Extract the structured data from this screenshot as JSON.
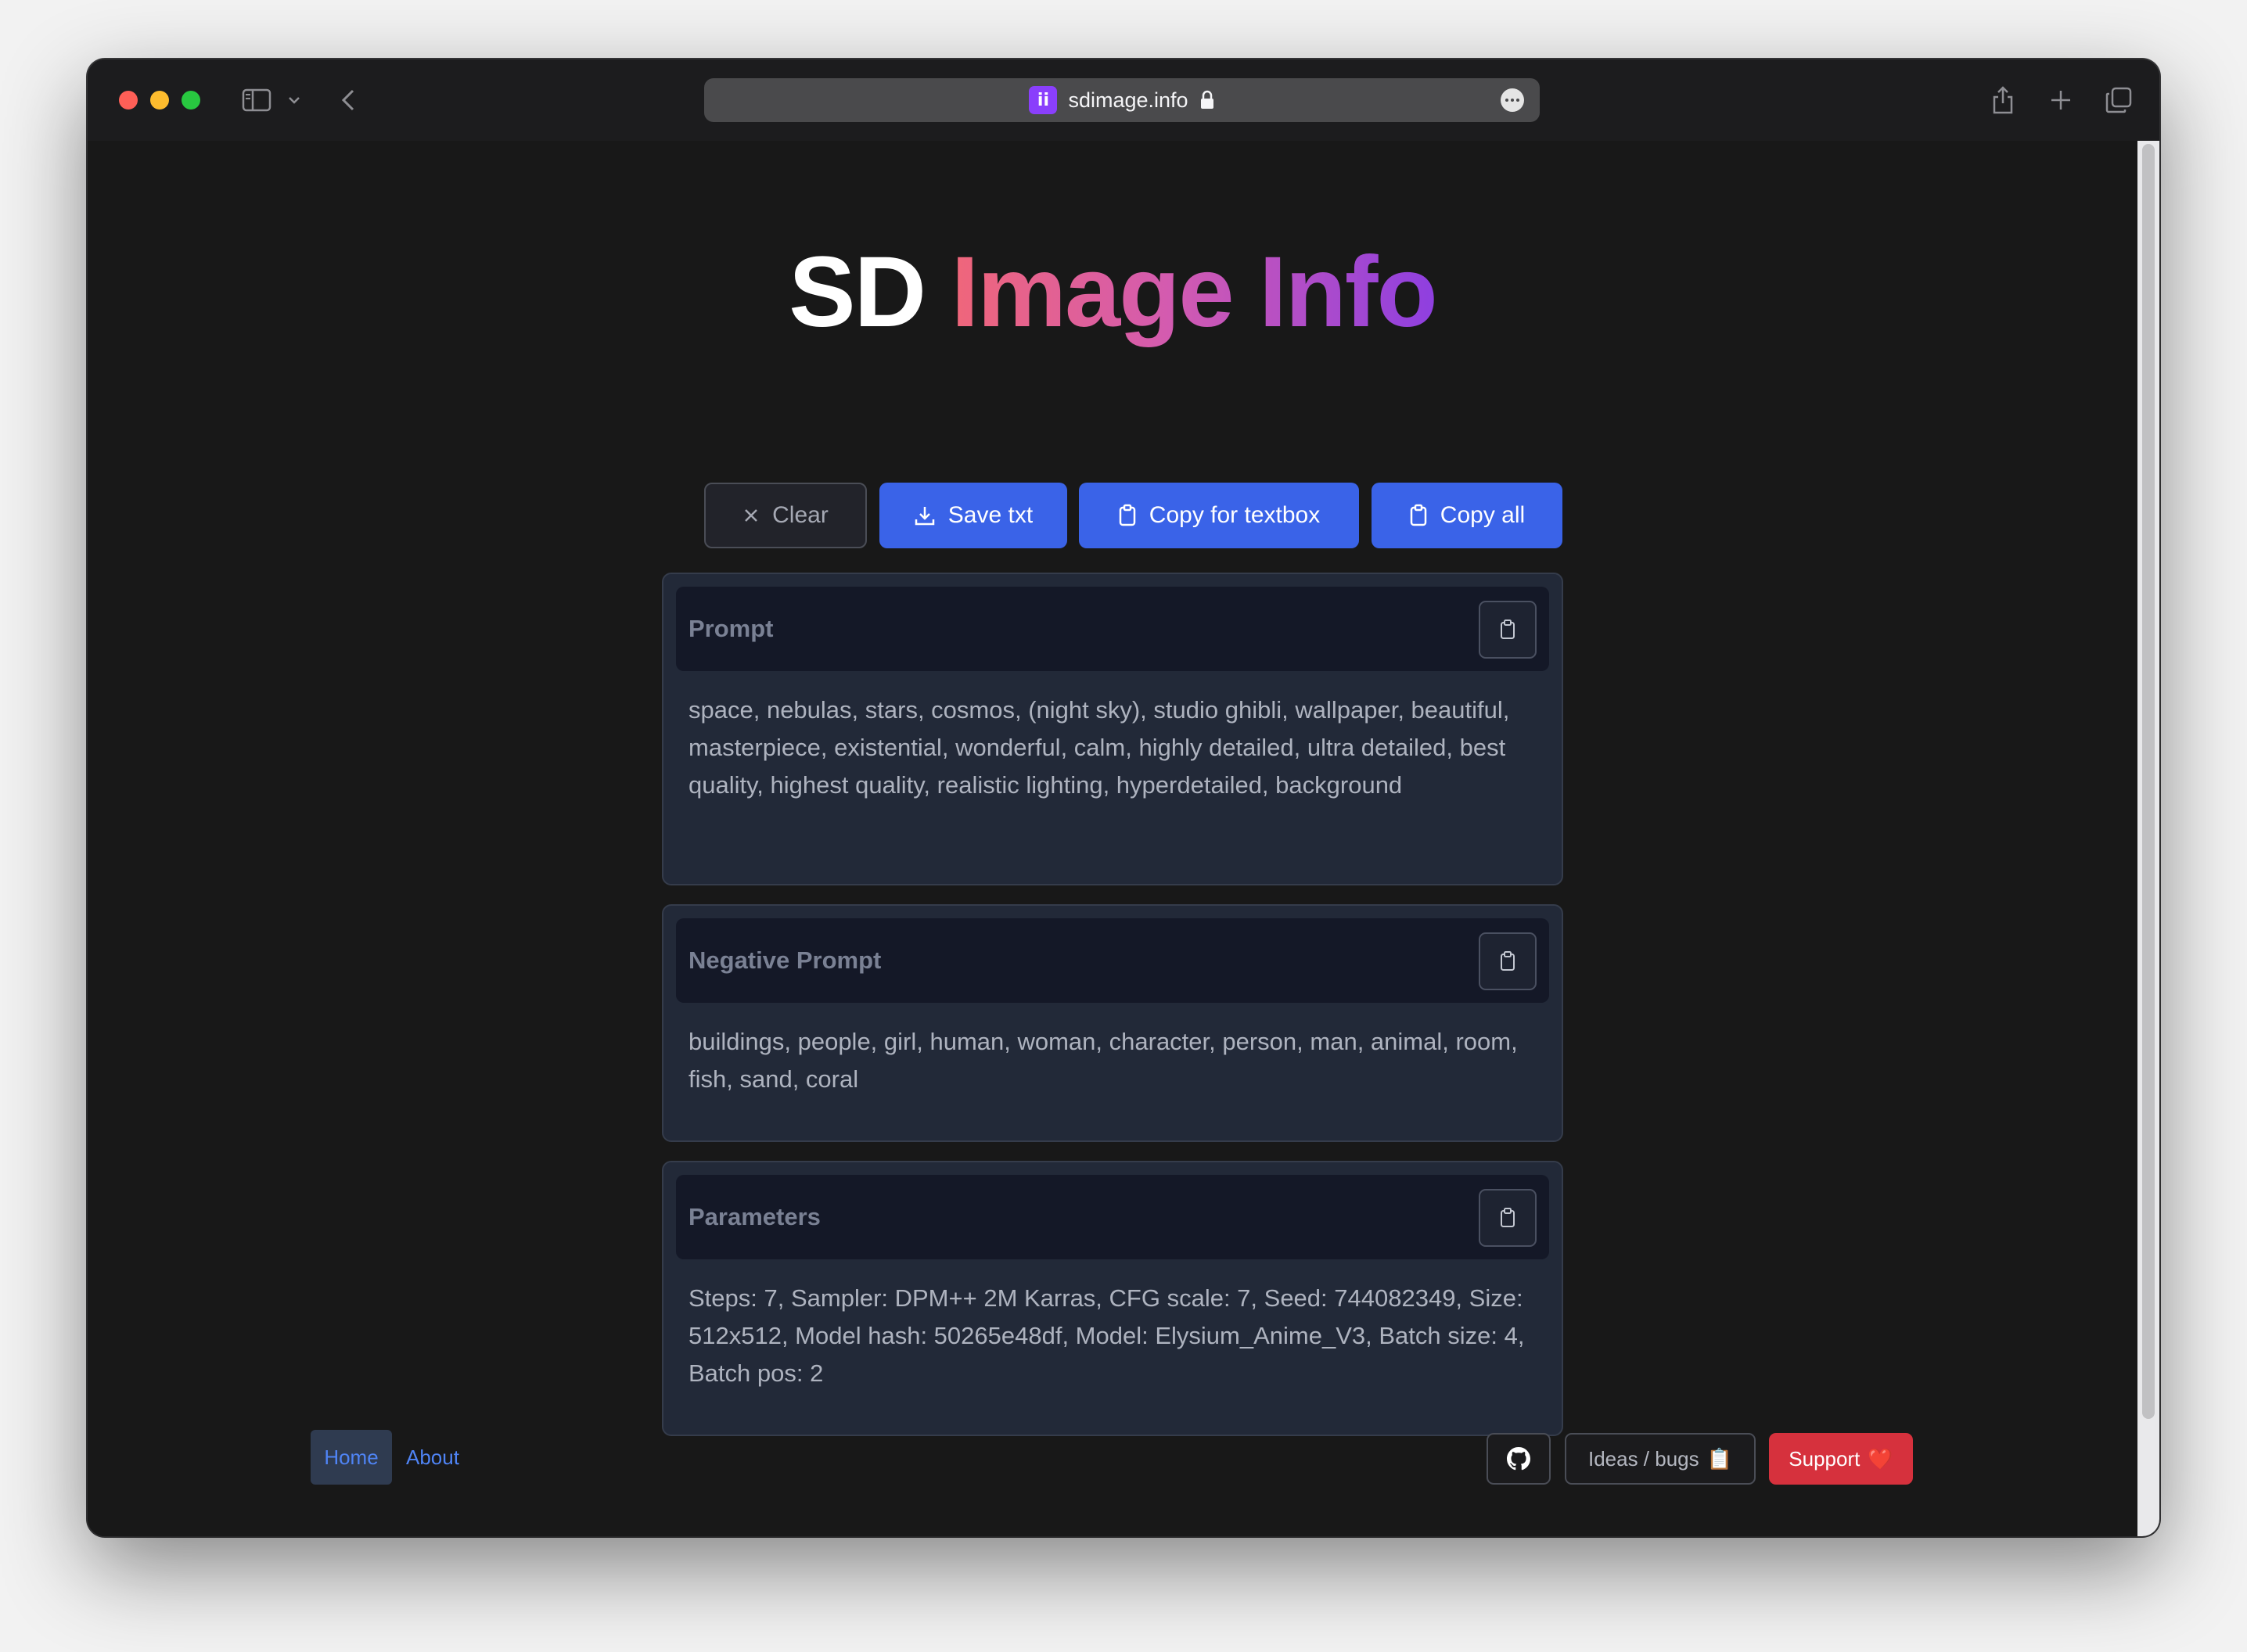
{
  "browser": {
    "url": "sdimage.info",
    "favicon_text": "ii"
  },
  "site": {
    "title_prefix": "SD",
    "title_highlight": "Image Info"
  },
  "toolbar": {
    "clear_label": "Clear",
    "save_label": "Save txt",
    "copy_textbox_label": "Copy for textbox",
    "copy_all_label": "Copy all"
  },
  "cards": {
    "prompt": {
      "title": "Prompt",
      "text": "space, nebulas, stars, cosmos, (night sky), studio ghibli, wallpaper, beautiful, masterpiece, existential, wonderful, calm, highly detailed, ultra detailed, best quality, highest quality, realistic lighting, hyperdetailed, background"
    },
    "negative": {
      "title": "Negative Prompt",
      "text": "buildings, people, girl, human, woman, character, person, man, animal, room, fish, sand, coral"
    },
    "parameters": {
      "title": "Parameters",
      "text": "Steps: 7, Sampler: DPM++ 2M Karras, CFG scale: 7, Seed: 744082349, Size: 512x512, Model hash: 50265e48df, Model: Elysium_Anime_V3, Batch size: 4, Batch pos: 2"
    }
  },
  "footer": {
    "nav_home": "Home",
    "nav_about": "About",
    "ideas_label": "Ideas / bugs",
    "ideas_emoji": "📋",
    "support_label": "Support",
    "support_emoji": "❤️"
  },
  "colors": {
    "accent_blue": "#3a63e8",
    "support_red": "#d6313d",
    "title_gradient_start": "#f0667a",
    "title_gradient_end": "#8e3fe0",
    "background": "#181818"
  }
}
